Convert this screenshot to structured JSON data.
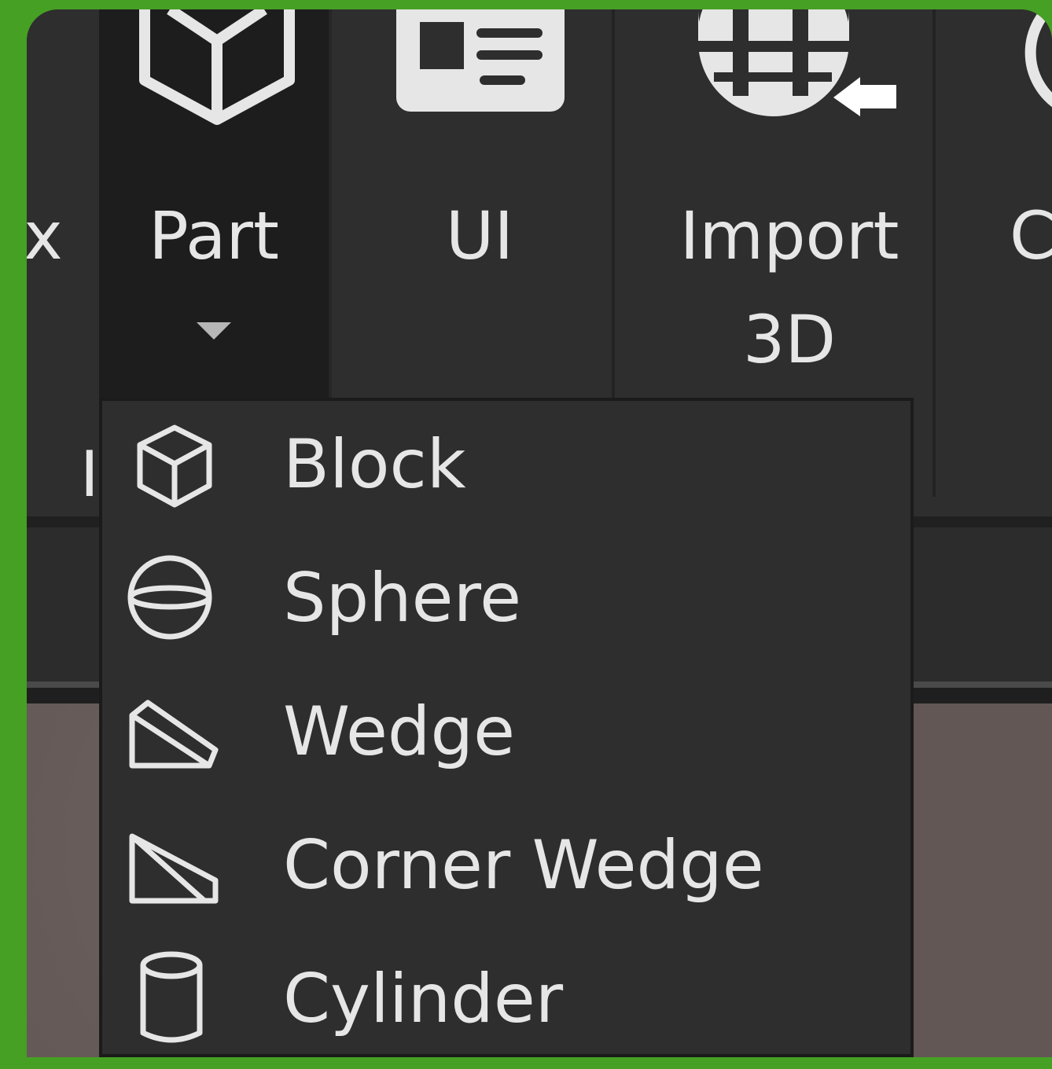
{
  "toolbar": {
    "left_fragment": "x",
    "part": {
      "label": "Part"
    },
    "ui": {
      "label": "UI"
    },
    "import3d": {
      "label_line1": "Import",
      "label_line2": "3D"
    },
    "right_fragment": "C",
    "group_label_fragment": "I"
  },
  "dropdown": {
    "items": [
      {
        "label": "Block",
        "icon": "cube-icon"
      },
      {
        "label": "Sphere",
        "icon": "sphere-icon"
      },
      {
        "label": "Wedge",
        "icon": "wedge-icon"
      },
      {
        "label": "Corner Wedge",
        "icon": "corner-wedge-icon"
      },
      {
        "label": "Cylinder",
        "icon": "cylinder-icon"
      }
    ]
  },
  "colors": {
    "background_green": "#46a023",
    "toolbar": "#2e2e2e",
    "part_selected": "#1d1d1d",
    "text": "#e6e6e6",
    "viewport": "#665a58"
  }
}
